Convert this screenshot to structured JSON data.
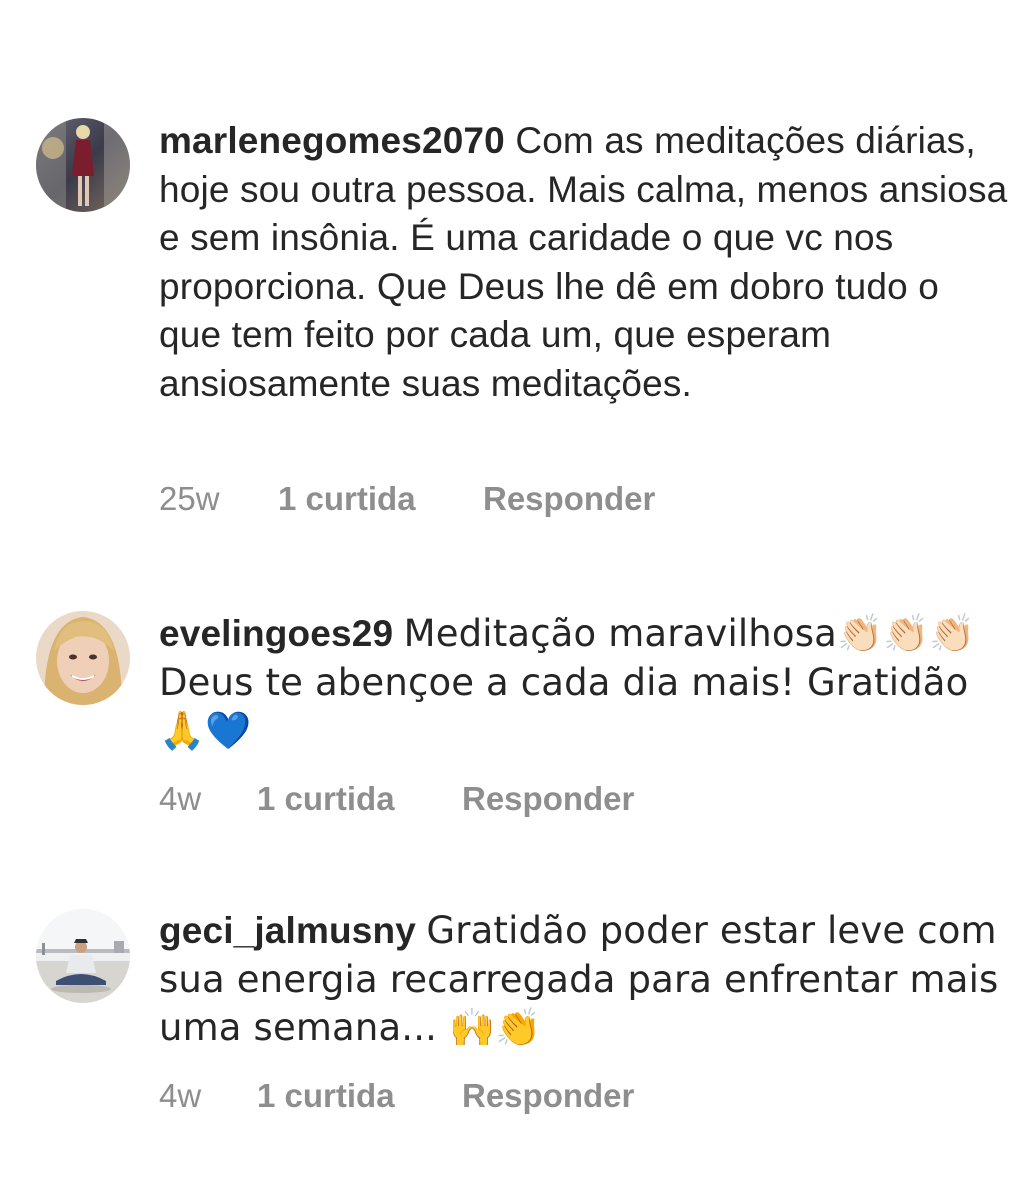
{
  "comments": [
    {
      "username": "marlenegomes2070",
      "text": "Com as meditações diárias, hoje sou outra pessoa. Mais calma, menos ansiosa e sem insônia. É uma caridade o que vc nos proporciona.  Que Deus lhe dê em dobro tudo o que tem feito por cada um, que esperam ansiosamente suas meditações.",
      "time": "25w",
      "likes": "1 curtida",
      "reply": "Responder",
      "avatar_icon": "avatar-photo-woman-dress"
    },
    {
      "username": "evelingoes29",
      "text": "Meditação maravilhosa👏🏻👏🏻👏🏻 Deus te abençoe a cada dia mais! Gratidão🙏💙",
      "time": "4w",
      "likes": "1 curtida",
      "reply": "Responder",
      "avatar_icon": "avatar-photo-woman-smile"
    },
    {
      "username": "geci_jalmusny",
      "text": "Gratidão poder estar leve com sua energia recarregada para enfrentar mais uma semana... 🙌👏",
      "time": "4w",
      "likes": "1 curtida",
      "reply": "Responder",
      "avatar_icon": "avatar-photo-man-sitting"
    }
  ]
}
